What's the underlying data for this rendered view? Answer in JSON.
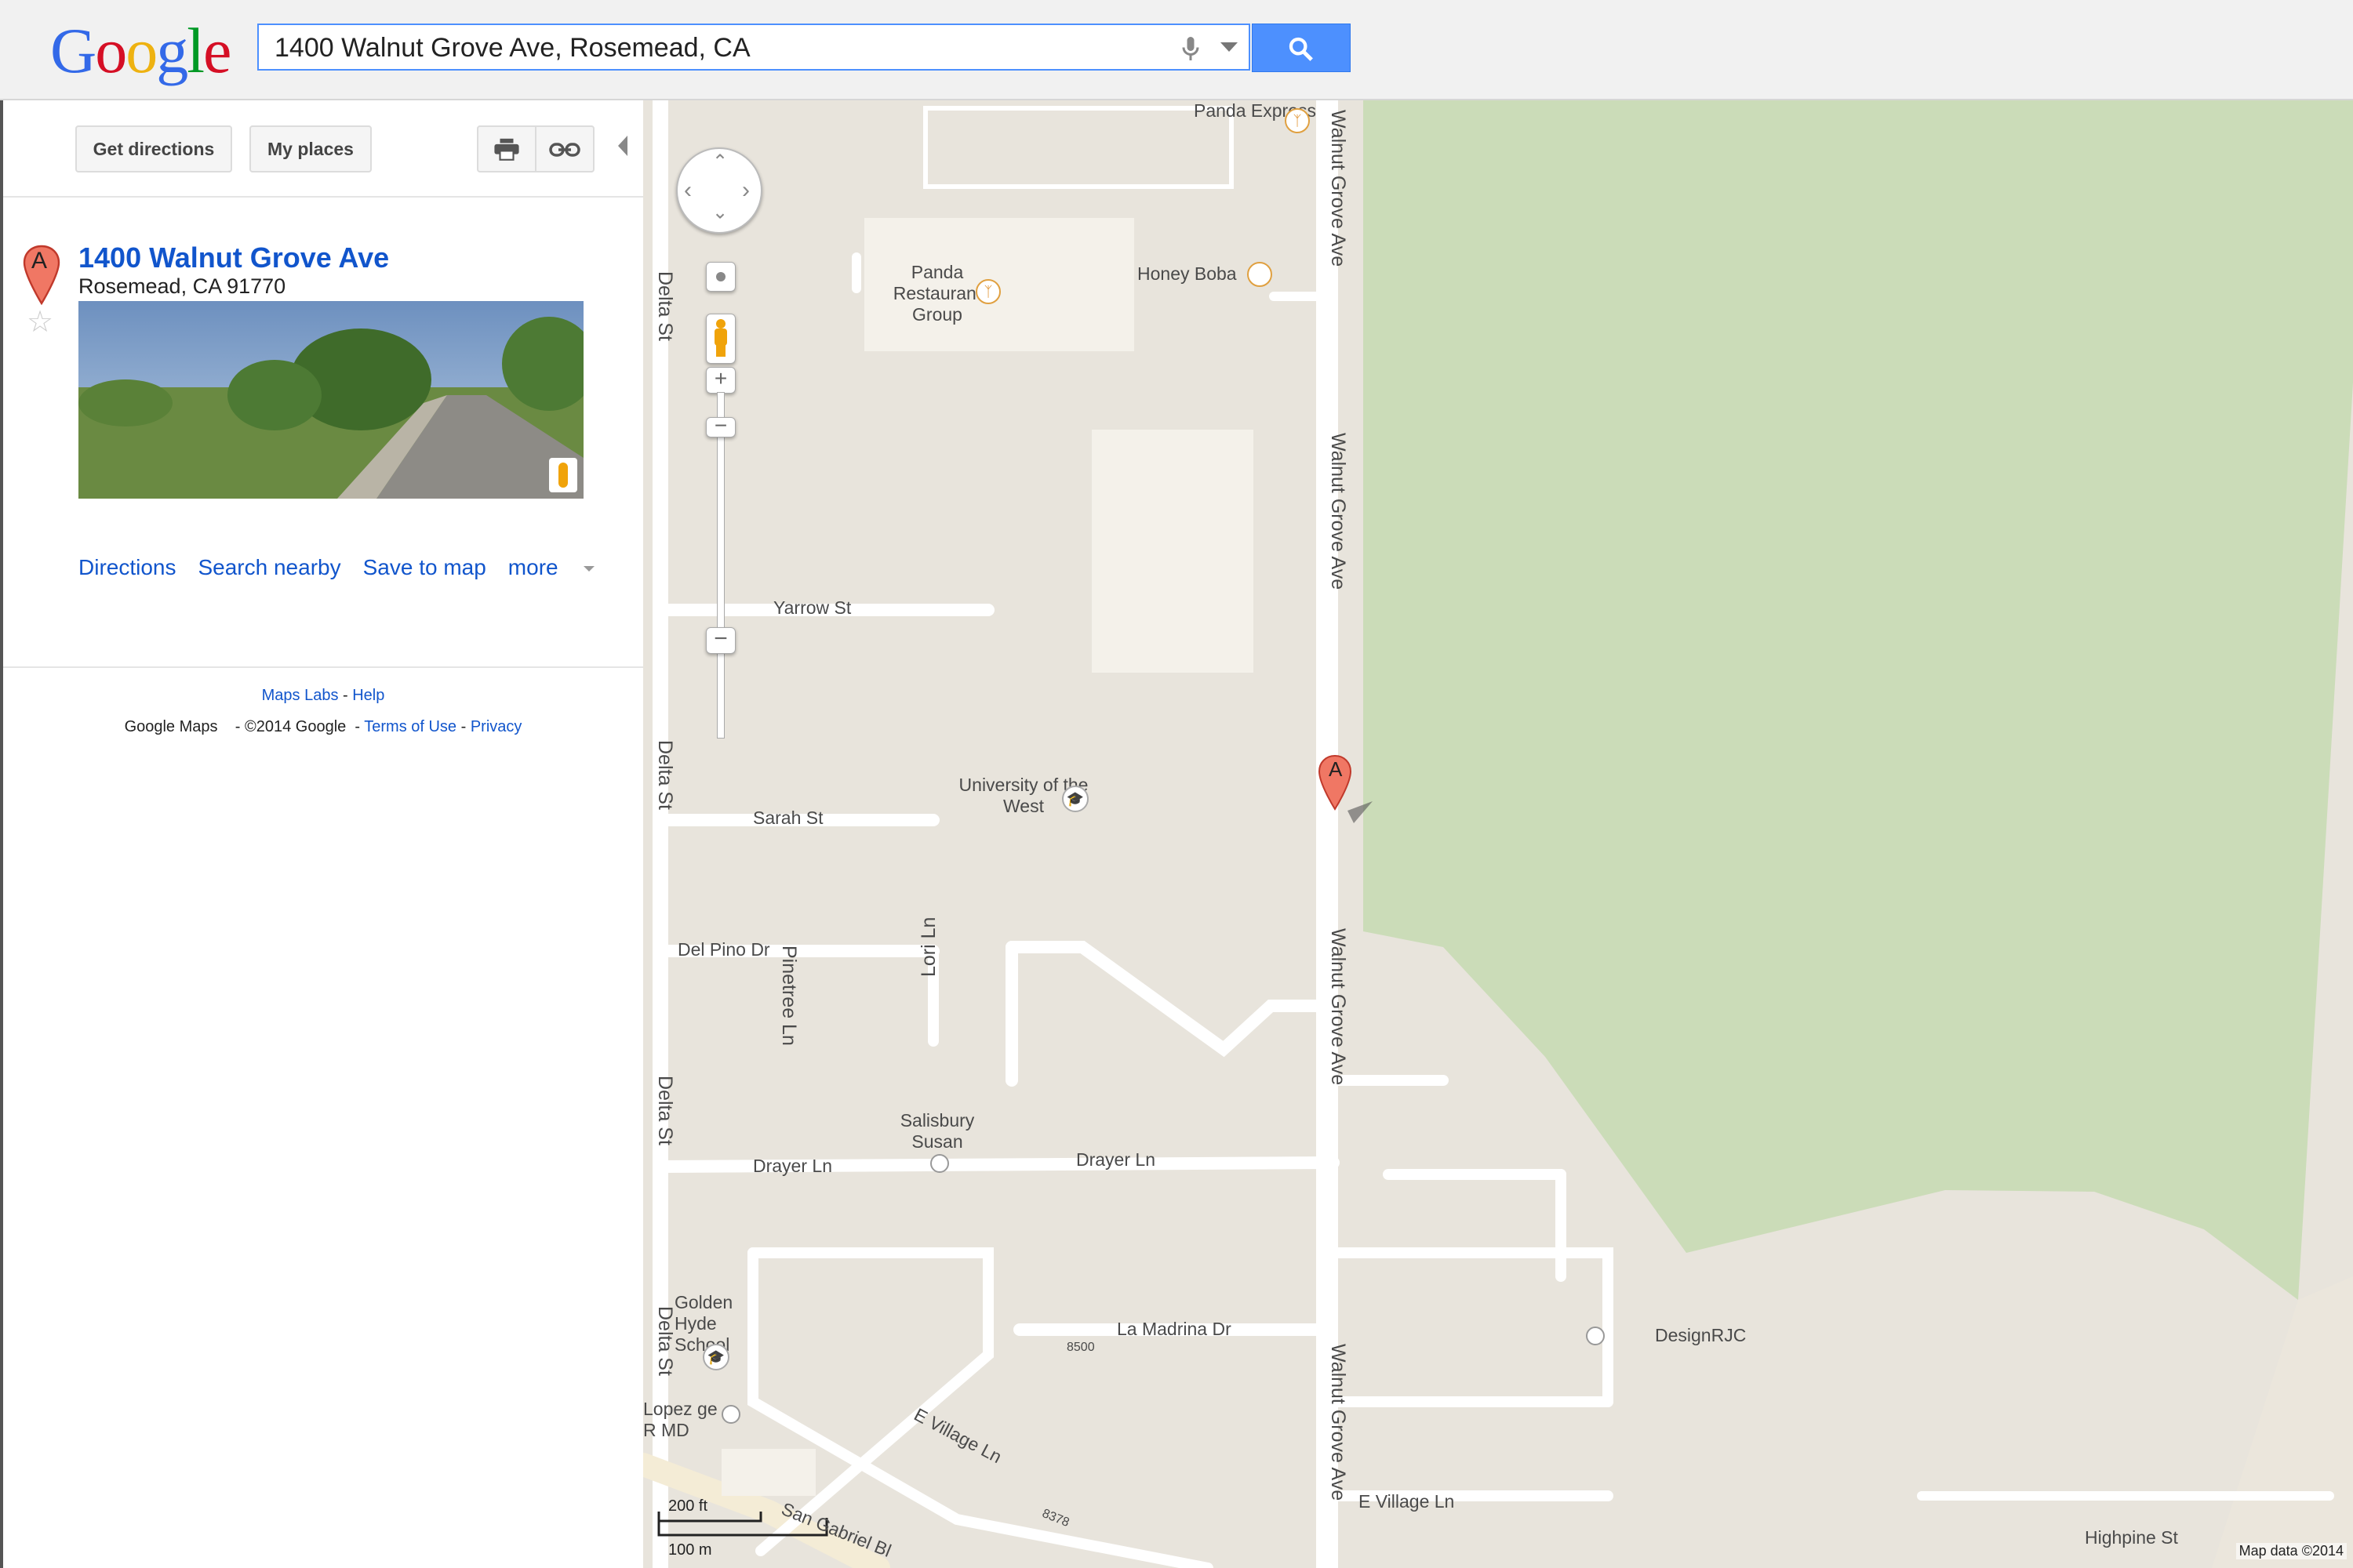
{
  "header": {
    "logo": [
      "G",
      "o",
      "o",
      "g",
      "l",
      "e"
    ],
    "search_value": "1400 Walnut Grove Ave, Rosemead, CA"
  },
  "sidebar": {
    "get_directions": "Get directions",
    "my_places": "My places",
    "result": {
      "marker_letter": "A",
      "title": "1400 Walnut Grove Ave",
      "address": "Rosemead, CA 91770"
    },
    "actions": [
      "Directions",
      "Search nearby",
      "Save to map",
      "more"
    ],
    "footer": {
      "maps_labs": "Maps Labs",
      "help": "Help",
      "google_maps": "Google Maps",
      "copyright": "©2014 Google",
      "terms": "Terms of Use",
      "privacy": "Privacy",
      "sep": " - "
    }
  },
  "map": {
    "marker_letter": "A",
    "streets": {
      "walnut_grove": "Walnut Grove Ave",
      "delta": "Delta St",
      "yarrow": "Yarrow St",
      "sarah": "Sarah St",
      "del_pino": "Del Pino Dr",
      "pinetree": "Pinetree Ln",
      "lori": "Lori Ln",
      "drayer": "Drayer Ln",
      "la_madrina": "La Madrina Dr",
      "e_village": "E Village Ln",
      "san_gabriel": "San Gabriel Bl",
      "highpine": "Highpine St"
    },
    "pois": {
      "panda_express": "Panda Express",
      "panda_group": "Panda Restaurant Group",
      "honey_boba": "Honey Boba",
      "university": "University of the West",
      "salisbury": "Salisbury Susan",
      "golden_hyde": "Golden Hyde School",
      "lopez": "Lopez ge R MD",
      "designrjc": "DesignRJC"
    },
    "numbers": [
      "8500",
      "8378"
    ],
    "scale": {
      "ft": "200 ft",
      "m": "100 m"
    },
    "attribution": "Map data ©2014"
  }
}
